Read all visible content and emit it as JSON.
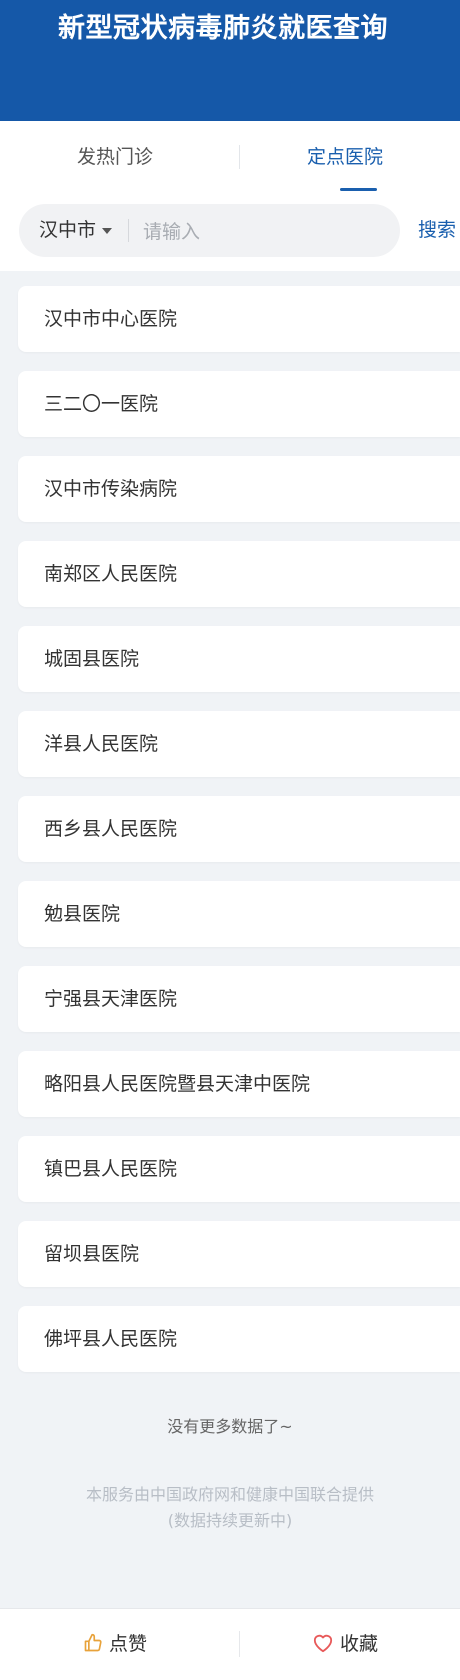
{
  "header": {
    "title": "新型冠状病毒肺炎就医查询"
  },
  "tabs": [
    {
      "label": "发热门诊",
      "active": false
    },
    {
      "label": "定点医院",
      "active": true
    }
  ],
  "search": {
    "city": "汉中市",
    "placeholder": "请输入",
    "value": "",
    "button_label": "搜索"
  },
  "hospitals": [
    "汉中市中心医院",
    "三二〇一医院",
    "汉中市传染病院",
    "南郑区人民医院",
    "城固县医院",
    "洋县人民医院",
    "西乡县人民医院",
    "勉县医院",
    "宁强县天津医院",
    "略阳县人民医院暨县天津中医院",
    "镇巴县人民医院",
    "留坝县医院",
    "佛坪县人民医院"
  ],
  "no_more_text": "没有更多数据了~",
  "footer": {
    "line1": "本服务由中国政府网和健康中国联合提供",
    "line2": "(数据持续更新中)"
  },
  "bottom_bar": {
    "like_label": "点赞",
    "favorite_label": "收藏"
  },
  "colors": {
    "header": "#1558a8",
    "accent": "#1a5fae",
    "background": "#f0f3f6",
    "like_icon": "#e8a23a",
    "favorite_icon": "#e85a5a"
  }
}
